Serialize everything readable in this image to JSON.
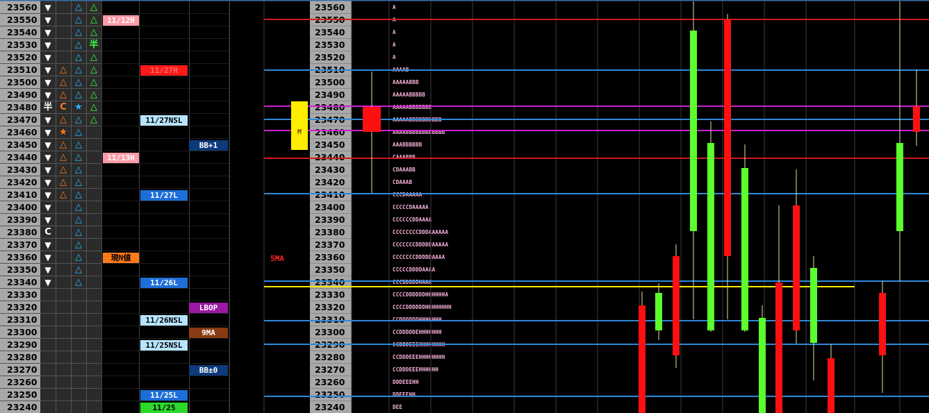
{
  "prices": [
    "23560",
    "23550",
    "23540",
    "23530",
    "23520",
    "23510",
    "23500",
    "23490",
    "23480",
    "23470",
    "23460",
    "23450",
    "23440",
    "23430",
    "23420",
    "23410",
    "23400",
    "23390",
    "23380",
    "23370",
    "23360",
    "23350",
    "23340",
    "23330",
    "23320",
    "23310",
    "23300",
    "23290",
    "23280",
    "23270",
    "23260",
    "23250",
    "23240"
  ],
  "marks": {
    "col1": [
      "▼",
      "▼",
      "▼",
      "▼",
      "▼",
      "▼",
      "▼",
      "▼",
      "半",
      "▼",
      "▼",
      "▼",
      "▼",
      "▼",
      "▼",
      "▼",
      "▼",
      "▼",
      "C",
      "▼",
      "▼",
      "▼",
      "▼",
      "",
      "",
      "",
      "",
      "",
      "",
      "",
      "",
      "",
      ""
    ],
    "col2": [
      "",
      "",
      "",
      "",
      "",
      "△",
      "△",
      "△",
      "C",
      "△",
      "★",
      "△",
      "△",
      "△",
      "△",
      "△",
      "",
      "",
      "",
      "",
      "",
      "",
      "",
      "",
      "",
      "",
      "",
      "",
      "",
      "",
      "",
      "",
      ""
    ],
    "col3": [
      "△",
      "△",
      "△",
      "△",
      "△",
      "△",
      "△",
      "△",
      "★",
      "△",
      "△",
      "△",
      "△",
      "△",
      "△",
      "△",
      "△",
      "△",
      "△",
      "△",
      "△",
      "△",
      "△",
      "",
      "",
      "",
      "",
      "",
      "",
      "",
      "",
      "",
      ""
    ],
    "col4": [
      "△",
      "△",
      "△",
      "半",
      "△",
      "△",
      "△",
      "△",
      "△",
      "△",
      "",
      "",
      "",
      "",
      "",
      "",
      "",
      "",
      "",
      "",
      "",
      "",
      "",
      "",
      "",
      "",
      "",
      "",
      "",
      "",
      "",
      "",
      ""
    ]
  },
  "colors": {
    "col1_mark": "#ffffff",
    "col2_mark": "#ff7a1a",
    "col3_mark": "#29b6ff",
    "col4_mark": "#39ff39",
    "price_bg": "#a8a8a8",
    "panel_bg": "#2b2b2b",
    "bull": "#5cff2c",
    "bear": "#ff1010"
  },
  "badges": [
    {
      "col": "a",
      "row": 1,
      "text": "11/12H",
      "bg": "#ff9aa6",
      "fg": "#ffffff"
    },
    {
      "col": "b",
      "row": 5,
      "text": "11/27H",
      "bg": "#ff1a1a",
      "fg": "#ff6a6a"
    },
    {
      "col": "b",
      "row": 9,
      "text": "11/27NSL",
      "bg": "#b8e4ff",
      "fg": "#000000"
    },
    {
      "col": "c",
      "row": 11,
      "text": "BB+1",
      "bg": "#0d3a7a",
      "fg": "#ffffff"
    },
    {
      "col": "a",
      "row": 12,
      "text": "11/13H",
      "bg": "#ff9aa6",
      "fg": "#ffffff"
    },
    {
      "col": "b",
      "row": 15,
      "text": "11/27L",
      "bg": "#1e6ed8",
      "fg": "#ffffff"
    },
    {
      "col": "a",
      "row": 20,
      "text": "現N値",
      "bg": "#ff7a1a",
      "fg": "#000000"
    },
    {
      "col": "b",
      "row": 22,
      "text": "11/26L",
      "bg": "#1e6ed8",
      "fg": "#ffffff"
    },
    {
      "col": "c",
      "row": 24,
      "text": "LBOP",
      "bg": "#9b19a3",
      "fg": "#ffffff"
    },
    {
      "col": "b",
      "row": 25,
      "text": "11/26NSL",
      "bg": "#b8e4ff",
      "fg": "#000000"
    },
    {
      "col": "c",
      "row": 26,
      "text": "9MA",
      "bg": "#8a3a12",
      "fg": "#ffffff"
    },
    {
      "col": "b",
      "row": 27,
      "text": "11/25NSL",
      "bg": "#b8e4ff",
      "fg": "#000000"
    },
    {
      "col": "c",
      "row": 29,
      "text": "BB±0",
      "bg": "#0d3a7a",
      "fg": "#ffffff"
    },
    {
      "col": "b",
      "row": 31,
      "text": "11/25L",
      "bg": "#1e6ed8",
      "fg": "#ffffff"
    },
    {
      "col": "b",
      "row": 32,
      "text": "11/25",
      "bg": "#2cd82c",
      "fg": "#000000"
    }
  ],
  "ma_label": "5MA",
  "m_label": "M",
  "tpo": [
    "A",
    "A",
    "A",
    "A",
    "A",
    "AAAAB",
    "AAAAABBB",
    "AAAAABBBBB",
    "AAAAABBBBBBB",
    "AAAAABBBBBBBBBB",
    "AAAABBBBBBBBBBBB",
    "AAABBBBBB",
    "CAAABBB",
    "CDAAABB",
    "CDAAAB",
    "CCCDAAAAA",
    "CCCCCDAAAAA",
    "CCCCCCDDAAAA",
    "CCCCCCCCDDDAAAAAA",
    "CCCCCCCDDDDDAAAAA",
    "CCCCCCCDDDDDAAAA",
    "CCCCCDDDDAAAA",
    "CCCDDDDDHAAA",
    "CCCCDDDDDDHHHHHHA",
    "CCCCDDDDDDHHHHHHHH",
    "CCDDDDDDHHHHHHH",
    "CCDDDDDEHHHHHHH",
    "CCDDDEEEHHHHHHHH",
    "CCDDDEEEHHHHHHHH",
    "CCDDDEEEHHHHHH",
    "DDDEEEHH",
    "DDEEEHH",
    "DEE"
  ]
}
